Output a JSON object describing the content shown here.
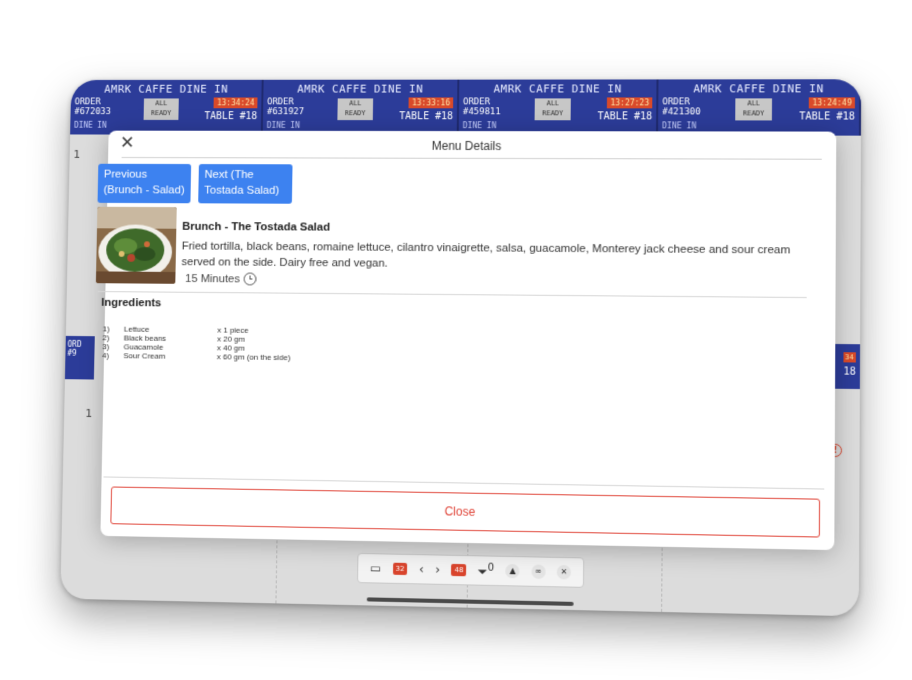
{
  "tickets": [
    {
      "title": "AMRK CAFFE DINE IN",
      "order_label": "ORDER",
      "order_no": "#672033",
      "ready": "ALL READY",
      "time": "13:34:24",
      "table": "TABLE #18",
      "dine": "DINE IN"
    },
    {
      "title": "AMRK CAFFE DINE IN",
      "order_label": "ORDER",
      "order_no": "#631927",
      "ready": "ALL READY",
      "time": "13:33:16",
      "table": "TABLE #18",
      "dine": "DINE IN"
    },
    {
      "title": "AMRK CAFFE DINE IN",
      "order_label": "ORDER",
      "order_no": "#459811",
      "ready": "ALL READY",
      "time": "13:27:23",
      "table": "TABLE #18",
      "dine": "DINE IN"
    },
    {
      "title": "AMRK CAFFE DINE IN",
      "order_label": "ORDER",
      "order_no": "#421300",
      "ready": "ALL READY",
      "time": "13:24:49",
      "table": "TABLE #18",
      "dine": "DINE IN"
    }
  ],
  "second_row": {
    "left_label": "ORD #9",
    "right_time": "34",
    "right_table": "18"
  },
  "bottom_bar": {
    "badge_left": "32",
    "badge_right": "48",
    "filter_count": "0"
  },
  "modal": {
    "close_x": "✕",
    "title": "Menu Details",
    "prev_button": "Previous (Brunch - Salad)",
    "next_button": "Next (The Tostada Salad)",
    "dish": {
      "name": "Brunch - The Tostada Salad",
      "description": "Fried tortilla, black beans, romaine lettuce, cilantro vinaigrette, salsa, guacamole, Monterey jack cheese and sour cream served on the side. Dairy free and vegan.",
      "time": "15 Minutes"
    },
    "ingredients_title": "Ingredients",
    "ingredients": [
      {
        "num": "1)",
        "name": "Lettuce",
        "qty": "x 1 piece"
      },
      {
        "num": "2)",
        "name": "Black beans",
        "qty": "x 20 gm"
      },
      {
        "num": "3)",
        "name": "Guacamole",
        "qty": "x 40 gm"
      },
      {
        "num": "4)",
        "name": "Sour Cream",
        "qty": "x 60 gm (on the side)"
      }
    ],
    "close_button": "Close"
  },
  "colors": {
    "ticket_blue": "#2c3c99",
    "accent_blue": "#3d82f0",
    "danger_red": "#e0463a"
  }
}
